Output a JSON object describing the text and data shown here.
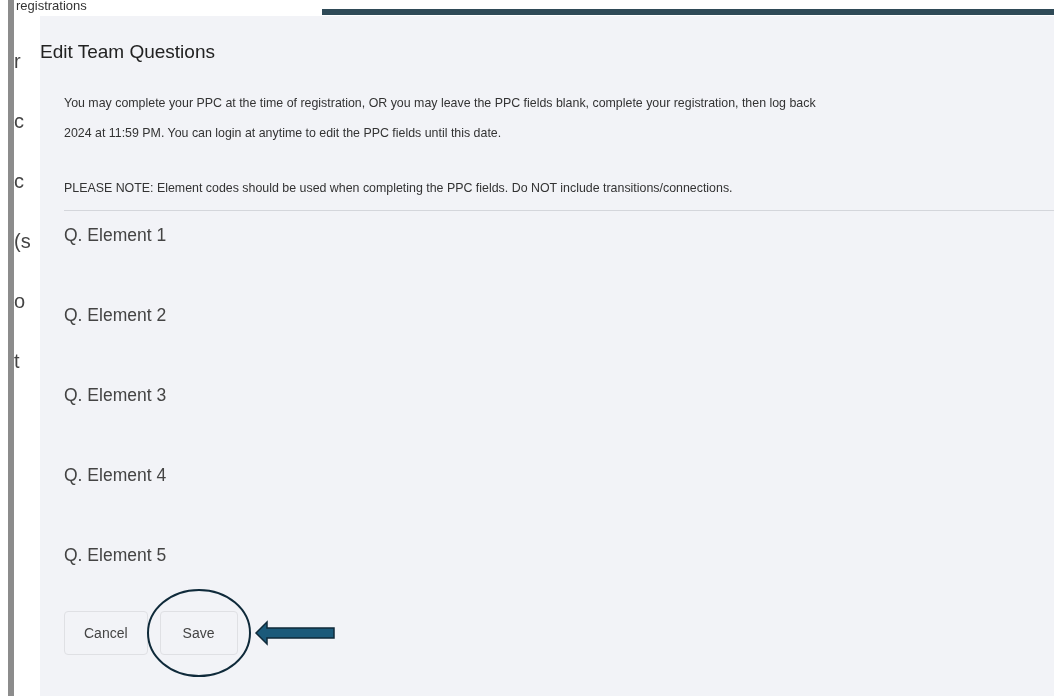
{
  "background": {
    "heading": "registrations",
    "fragments": [
      "r",
      "c",
      "c",
      "(s",
      "o",
      "t"
    ]
  },
  "modal": {
    "title": "Edit Team Questions",
    "intro_lines": [
      "You may complete your PPC at the time of registration, OR you may leave the PPC fields blank, complete your registration, then log back",
      "2024 at 11:59 PM. You can login at anytime to edit the PPC fields until this date."
    ],
    "note": "PLEASE NOTE: Element codes should be used when completing the PPC fields. Do NOT include transitions/connections.",
    "questions": [
      {
        "label": "Q. Element 1"
      },
      {
        "label": "Q. Element 2"
      },
      {
        "label": "Q. Element 3"
      },
      {
        "label": "Q. Element 4"
      },
      {
        "label": "Q. Element 5"
      }
    ],
    "buttons": [
      {
        "label": "Cancel",
        "highlighted": false
      },
      {
        "label": "Save",
        "highlighted": true
      }
    ]
  }
}
